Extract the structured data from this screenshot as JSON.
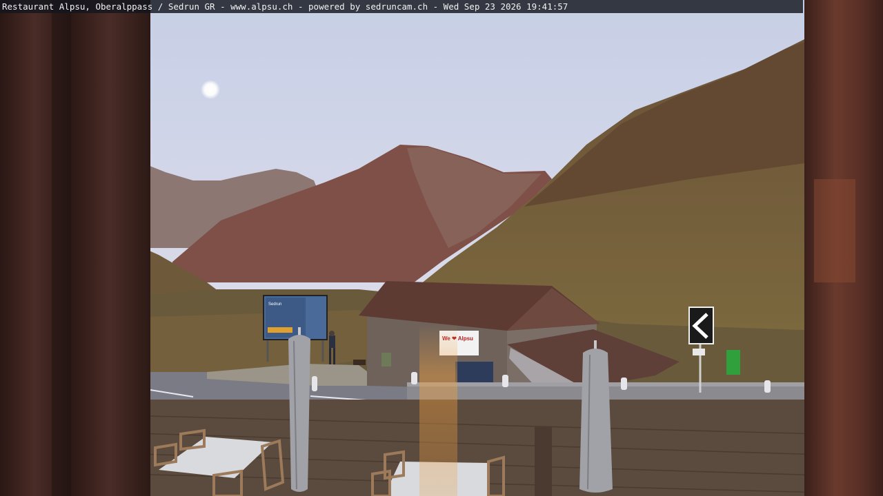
{
  "caption": {
    "text": "Restaurant Alpsu, Oberalppass / Sedrun GR - www.alpsu.ch - powered by sedruncam.ch -  Wed Sep 23 2026 19:41:57"
  },
  "scene": {
    "hut_sign_text": "We ❤ Alpsu",
    "billboard_text": "Sedrun"
  },
  "colors": {
    "sky_top": "#c9d0e6",
    "sky_bottom": "#e4e2ec",
    "mountain_far": "#8f7a78",
    "mountain_mid": "#7a4e45",
    "slope_right": "#6b5234",
    "road": "#7b7c86",
    "window_frame": "#3d2420",
    "hut_roof": "#5c3b33",
    "bin_green": "#2fa03c"
  }
}
